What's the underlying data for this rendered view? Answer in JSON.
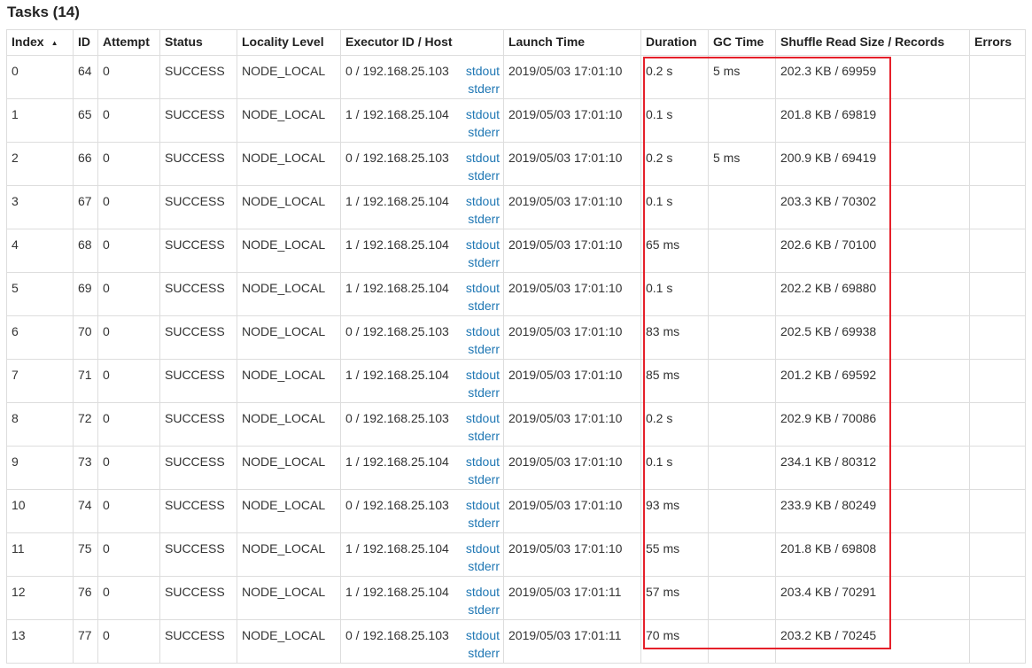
{
  "title": "Tasks (14)",
  "highlight_color": "#e5202a",
  "link_color": "#1f77b4",
  "columns": [
    "Index",
    "ID",
    "Attempt",
    "Status",
    "Locality Level",
    "Executor ID / Host",
    "Launch Time",
    "Duration",
    "GC Time",
    "Shuffle Read Size / Records",
    "Errors"
  ],
  "sort_indicator": "▲",
  "log_links": {
    "stdout": "stdout",
    "stderr": "stderr"
  },
  "rows": [
    {
      "index": "0",
      "id": "64",
      "attempt": "0",
      "status": "SUCCESS",
      "locality": "NODE_LOCAL",
      "executor": "0 / 192.168.25.103",
      "launch": "2019/05/03 17:01:10",
      "duration": "0.2 s",
      "gc": "5 ms",
      "shuffle": "202.3 KB / 69959",
      "errors": ""
    },
    {
      "index": "1",
      "id": "65",
      "attempt": "0",
      "status": "SUCCESS",
      "locality": "NODE_LOCAL",
      "executor": "1 / 192.168.25.104",
      "launch": "2019/05/03 17:01:10",
      "duration": "0.1 s",
      "gc": "",
      "shuffle": "201.8 KB / 69819",
      "errors": ""
    },
    {
      "index": "2",
      "id": "66",
      "attempt": "0",
      "status": "SUCCESS",
      "locality": "NODE_LOCAL",
      "executor": "0 / 192.168.25.103",
      "launch": "2019/05/03 17:01:10",
      "duration": "0.2 s",
      "gc": "5 ms",
      "shuffle": "200.9 KB / 69419",
      "errors": ""
    },
    {
      "index": "3",
      "id": "67",
      "attempt": "0",
      "status": "SUCCESS",
      "locality": "NODE_LOCAL",
      "executor": "1 / 192.168.25.104",
      "launch": "2019/05/03 17:01:10",
      "duration": "0.1 s",
      "gc": "",
      "shuffle": "203.3 KB / 70302",
      "errors": ""
    },
    {
      "index": "4",
      "id": "68",
      "attempt": "0",
      "status": "SUCCESS",
      "locality": "NODE_LOCAL",
      "executor": "1 / 192.168.25.104",
      "launch": "2019/05/03 17:01:10",
      "duration": "65 ms",
      "gc": "",
      "shuffle": "202.6 KB / 70100",
      "errors": ""
    },
    {
      "index": "5",
      "id": "69",
      "attempt": "0",
      "status": "SUCCESS",
      "locality": "NODE_LOCAL",
      "executor": "1 / 192.168.25.104",
      "launch": "2019/05/03 17:01:10",
      "duration": "0.1 s",
      "gc": "",
      "shuffle": "202.2 KB / 69880",
      "errors": ""
    },
    {
      "index": "6",
      "id": "70",
      "attempt": "0",
      "status": "SUCCESS",
      "locality": "NODE_LOCAL",
      "executor": "0 / 192.168.25.103",
      "launch": "2019/05/03 17:01:10",
      "duration": "83 ms",
      "gc": "",
      "shuffle": "202.5 KB / 69938",
      "errors": ""
    },
    {
      "index": "7",
      "id": "71",
      "attempt": "0",
      "status": "SUCCESS",
      "locality": "NODE_LOCAL",
      "executor": "1 / 192.168.25.104",
      "launch": "2019/05/03 17:01:10",
      "duration": "85 ms",
      "gc": "",
      "shuffle": "201.2 KB / 69592",
      "errors": ""
    },
    {
      "index": "8",
      "id": "72",
      "attempt": "0",
      "status": "SUCCESS",
      "locality": "NODE_LOCAL",
      "executor": "0 / 192.168.25.103",
      "launch": "2019/05/03 17:01:10",
      "duration": "0.2 s",
      "gc": "",
      "shuffle": "202.9 KB / 70086",
      "errors": ""
    },
    {
      "index": "9",
      "id": "73",
      "attempt": "0",
      "status": "SUCCESS",
      "locality": "NODE_LOCAL",
      "executor": "1 / 192.168.25.104",
      "launch": "2019/05/03 17:01:10",
      "duration": "0.1 s",
      "gc": "",
      "shuffle": "234.1 KB / 80312",
      "errors": ""
    },
    {
      "index": "10",
      "id": "74",
      "attempt": "0",
      "status": "SUCCESS",
      "locality": "NODE_LOCAL",
      "executor": "0 / 192.168.25.103",
      "launch": "2019/05/03 17:01:10",
      "duration": "93 ms",
      "gc": "",
      "shuffle": "233.9 KB / 80249",
      "errors": ""
    },
    {
      "index": "11",
      "id": "75",
      "attempt": "0",
      "status": "SUCCESS",
      "locality": "NODE_LOCAL",
      "executor": "1 / 192.168.25.104",
      "launch": "2019/05/03 17:01:10",
      "duration": "55 ms",
      "gc": "",
      "shuffle": "201.8 KB / 69808",
      "errors": ""
    },
    {
      "index": "12",
      "id": "76",
      "attempt": "0",
      "status": "SUCCESS",
      "locality": "NODE_LOCAL",
      "executor": "1 / 192.168.25.104",
      "launch": "2019/05/03 17:01:11",
      "duration": "57 ms",
      "gc": "",
      "shuffle": "203.4 KB / 70291",
      "errors": ""
    },
    {
      "index": "13",
      "id": "77",
      "attempt": "0",
      "status": "SUCCESS",
      "locality": "NODE_LOCAL",
      "executor": "0 / 192.168.25.103",
      "launch": "2019/05/03 17:01:11",
      "duration": "70 ms",
      "gc": "",
      "shuffle": "203.2 KB / 70245",
      "errors": ""
    }
  ]
}
